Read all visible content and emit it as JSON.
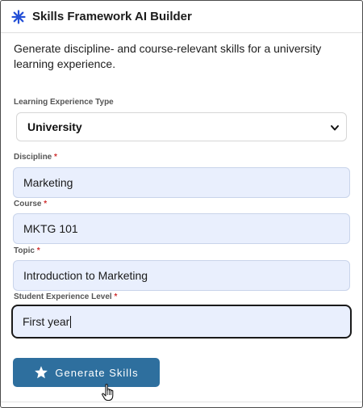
{
  "header": {
    "title": "Skills Framework AI Builder",
    "icon": "sparkle-icon",
    "icon_color": "#2450d6"
  },
  "description": "Generate discipline- and course-relevant skills for a university learning experience.",
  "form": {
    "experience_type": {
      "label": "Learning Experience Type",
      "value": "University"
    },
    "discipline": {
      "label": "Discipline",
      "required_mark": "*",
      "value": "Marketing"
    },
    "course": {
      "label": "Course",
      "required_mark": "*",
      "value": "MKTG 101"
    },
    "topic": {
      "label": "Topic",
      "required_mark": "*",
      "value": "Introduction to Marketing"
    },
    "student_level": {
      "label": "Student Experience Level",
      "required_mark": "*",
      "value": "First year"
    }
  },
  "generate_button": {
    "label": "Generate Skills",
    "icon": "star-icon",
    "color": "#2e6f9e"
  },
  "colors": {
    "field_bg": "#e9effd",
    "required": "#d03030"
  }
}
